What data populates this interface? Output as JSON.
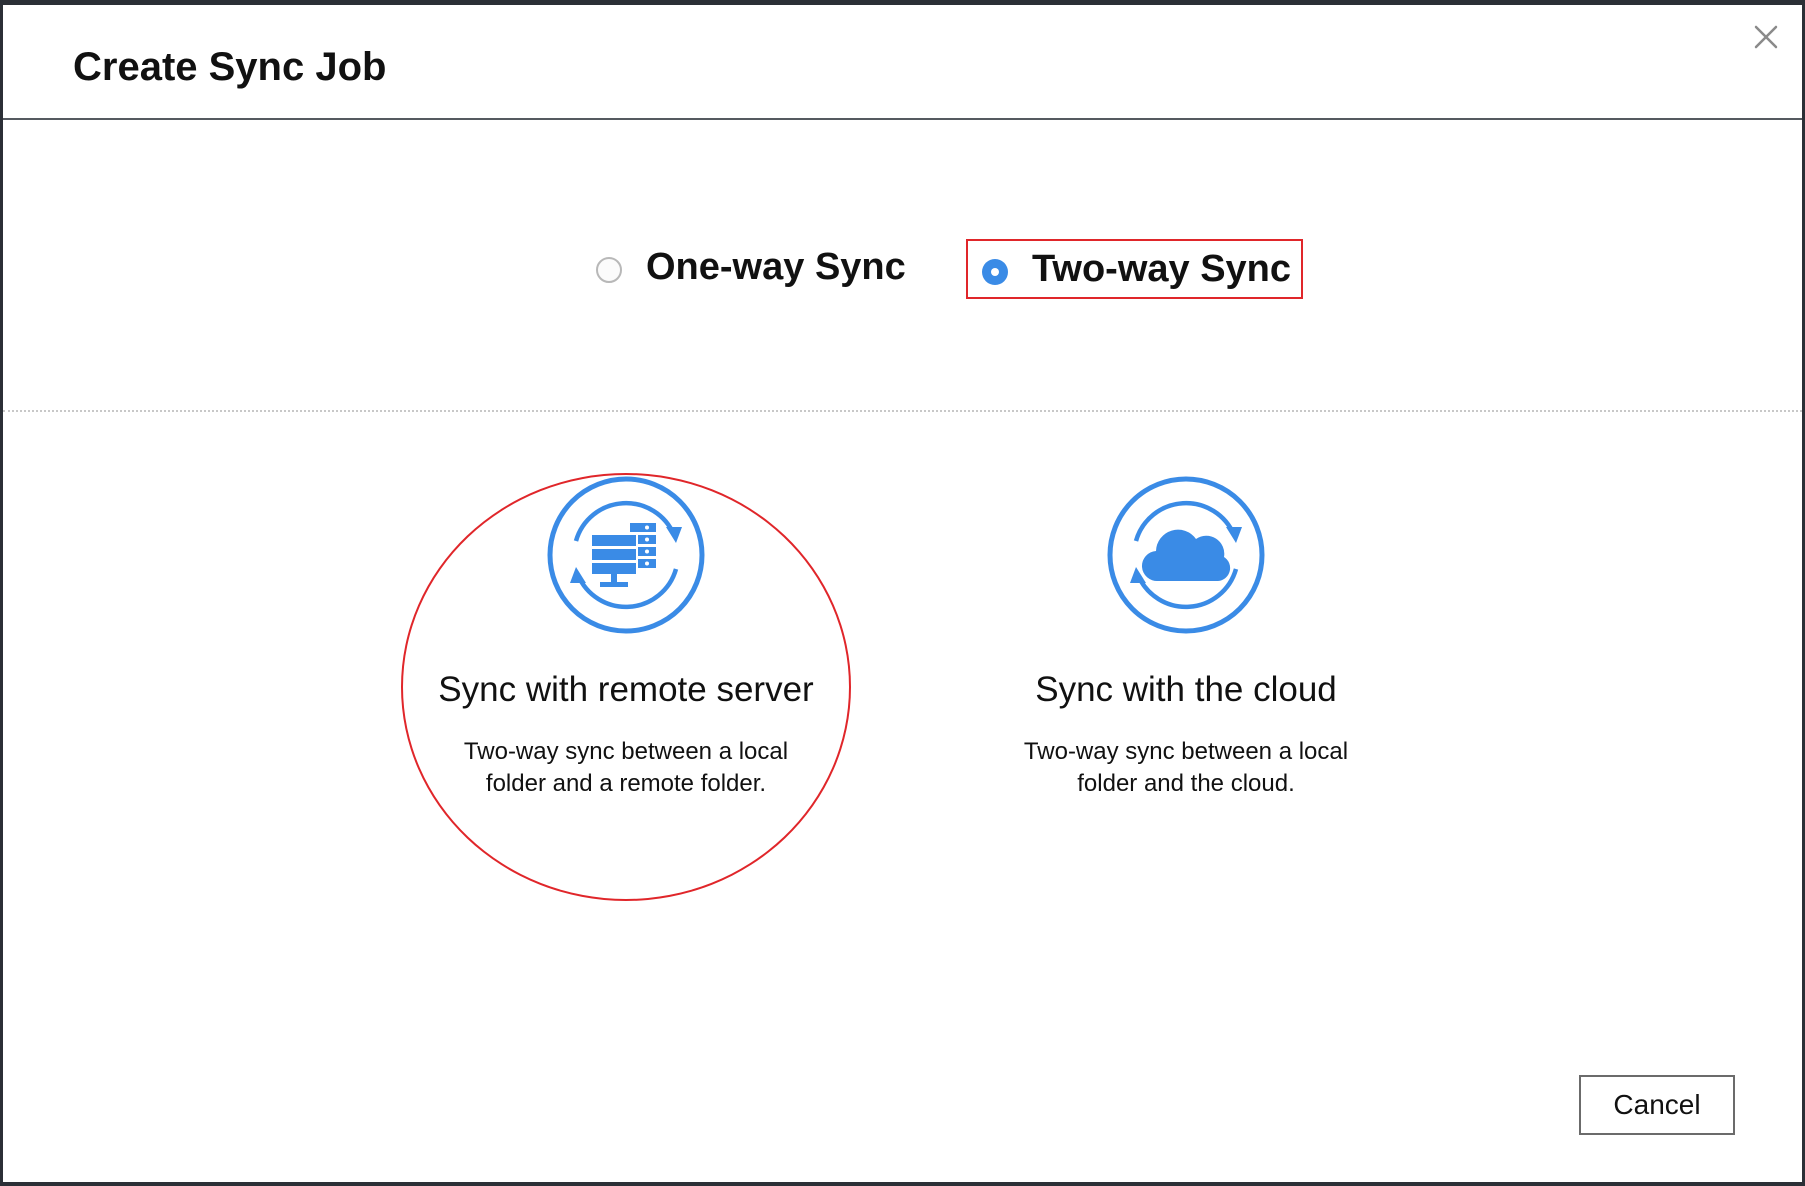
{
  "dialog": {
    "title": "Create Sync Job",
    "close_icon": "close-icon"
  },
  "sync_types": {
    "options": [
      {
        "label": "One-way Sync",
        "selected": false
      },
      {
        "label": "Two-way Sync",
        "selected": true
      }
    ]
  },
  "sync_targets": {
    "items": [
      {
        "title": "Sync with remote server",
        "description": "Two-way sync between a local folder and a remote folder.",
        "icon": "server-sync-icon"
      },
      {
        "title": "Sync with the cloud",
        "description": "Two-way sync between a local folder and the cloud.",
        "icon": "cloud-sync-icon"
      }
    ]
  },
  "footer": {
    "cancel_label": "Cancel"
  },
  "colors": {
    "accent": "#3a8be6",
    "highlight": "#e0262a"
  }
}
